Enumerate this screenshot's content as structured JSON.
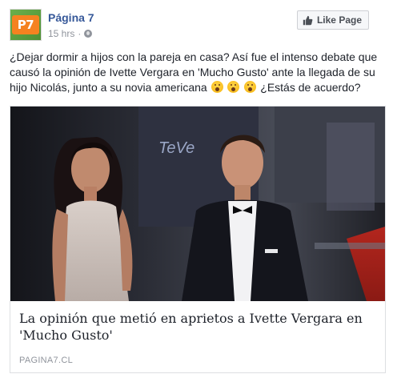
{
  "header": {
    "page_name": "Página 7",
    "avatar_text": "P7",
    "time": "15 hrs",
    "privacy_icon": "globe-icon",
    "like_button_label": "Like Page",
    "like_icon": "thumbs-up-icon"
  },
  "post": {
    "text_part1": "¿Dejar dormir a hijos con la pareja en casa? Así fue el intenso debate que causó la opinión de Ivette Vergara en 'Mucho Gusto' ante la llegada de su hijo Nicolás, junto a su novia americana",
    "emoji": [
      "astonished-face",
      "astonished-face",
      "astonished-face"
    ],
    "text_part2": "¿Estás de acuerdo?"
  },
  "link": {
    "image_alt": "Ivette Vergara y Fernando Solabarrieta en alfombra roja",
    "backdrop_logo": "TeVe",
    "title": "La opinión que metió en aprietos a Ivette Vergara en 'Mucho Gusto'",
    "domain": "PAGINA7.CL"
  },
  "colors": {
    "page_name": "#365899",
    "text": "#1d2129",
    "meta": "#90949c",
    "avatar_green": "#5a9e3e",
    "avatar_orange": "#f58220"
  }
}
